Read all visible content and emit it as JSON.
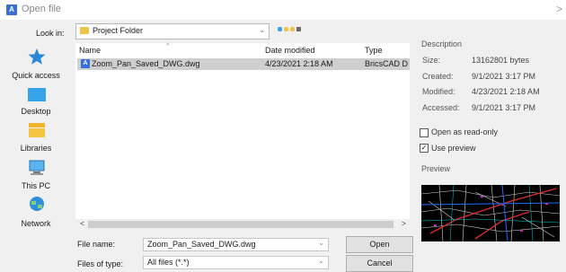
{
  "window": {
    "title": "Open file",
    "app_icon_letter": "A",
    "close_glyph": ">"
  },
  "look_in": {
    "label": "Look in:",
    "value": "Project Folder"
  },
  "places": [
    {
      "name": "quick-access",
      "label": "Quick access"
    },
    {
      "name": "desktop",
      "label": "Desktop"
    },
    {
      "name": "libraries",
      "label": "Libraries"
    },
    {
      "name": "this-pc",
      "label": "This PC"
    },
    {
      "name": "network",
      "label": "Network"
    }
  ],
  "file_list": {
    "columns": [
      "Name",
      "Date modified",
      "Type"
    ],
    "rows": [
      {
        "icon_letter": "A",
        "name": "Zoom_Pan_Saved_DWG.dwg",
        "date": "4/23/2021 2:18 AM",
        "type": "BricsCAD Di"
      }
    ]
  },
  "scroll": {
    "left": "<",
    "right": ">"
  },
  "file_name": {
    "label": "File name:",
    "value": "Zoom_Pan_Saved_DWG.dwg"
  },
  "file_type": {
    "label": "Files of type:",
    "value": "All files (*.*)"
  },
  "buttons": {
    "open": "Open",
    "cancel": "Cancel"
  },
  "description": {
    "title": "Description",
    "size_label": "Size:",
    "size_value": "13162801 bytes",
    "created_label": "Created:",
    "created_value": "9/1/2021 3:17 PM",
    "modified_label": "Modified:",
    "modified_value": "4/23/2021 2:18 AM",
    "accessed_label": "Accessed:",
    "accessed_value": "9/1/2021 3:17 PM"
  },
  "options": {
    "read_only_label": "Open as read-only",
    "read_only_checked": false,
    "use_preview_label": "Use preview",
    "use_preview_checked": true
  },
  "preview": {
    "title": "Preview"
  },
  "colors": {
    "accent": "#3b6fd8",
    "selection": "#cfcfcf",
    "folder": "#f1c24a",
    "preview_bg": "#000000"
  }
}
